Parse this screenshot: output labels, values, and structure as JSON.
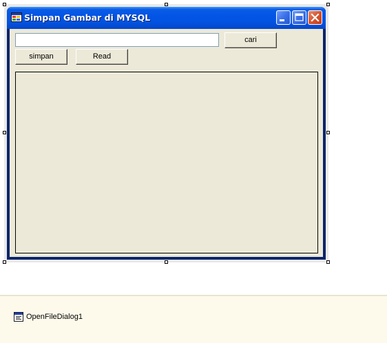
{
  "window": {
    "title": "Simpan Gambar di MYSQL",
    "icon": "form-app-icon",
    "caption_buttons": [
      "minimize-icon",
      "maximize-icon",
      "close-icon"
    ]
  },
  "form": {
    "search_input_value": "",
    "cari_label": "cari",
    "simpan_label": "simpan",
    "read_label": "Read"
  },
  "component_tray": {
    "items": [
      {
        "label": "OpenFileDialog1",
        "icon": "open-file-dialog-icon"
      }
    ]
  },
  "colors": {
    "title_bar": "#0355e6",
    "client_background": "#ece9d8",
    "tray_background": "#fdfaeb",
    "close_button": "#d7542f"
  }
}
